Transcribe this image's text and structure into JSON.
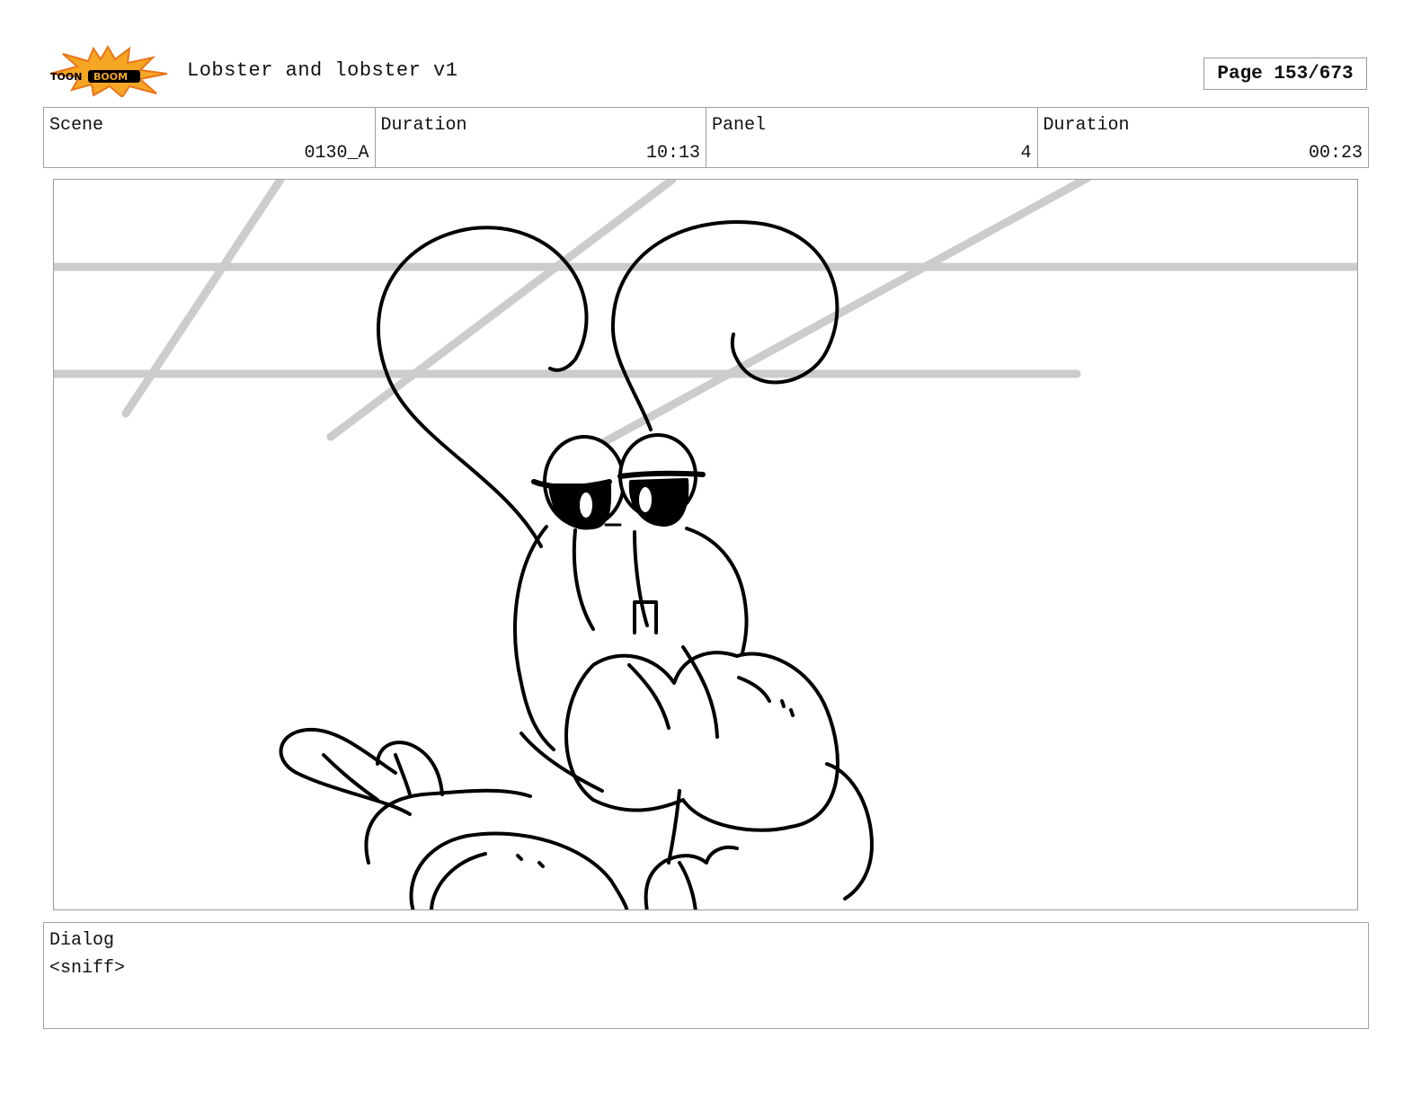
{
  "header": {
    "logo_text_left": "TOON",
    "logo_text_right": "BOOM",
    "title": "Lobster and lobster v1",
    "page": "Page 153/673"
  },
  "info": {
    "scene_label": "Scene",
    "scene_value": "0130_A",
    "scene_duration_label": "Duration",
    "scene_duration_value": "10:13",
    "panel_label": "Panel",
    "panel_value": "4",
    "panel_duration_label": "Duration",
    "panel_duration_value": "00:23"
  },
  "dialog": {
    "label": "Dialog",
    "text": "<sniff>"
  },
  "colors": {
    "logo_burst": "#f5a623",
    "logo_burst_outer": "#e8761a",
    "guide_lines": "#cccccc",
    "ink": "#000000"
  }
}
